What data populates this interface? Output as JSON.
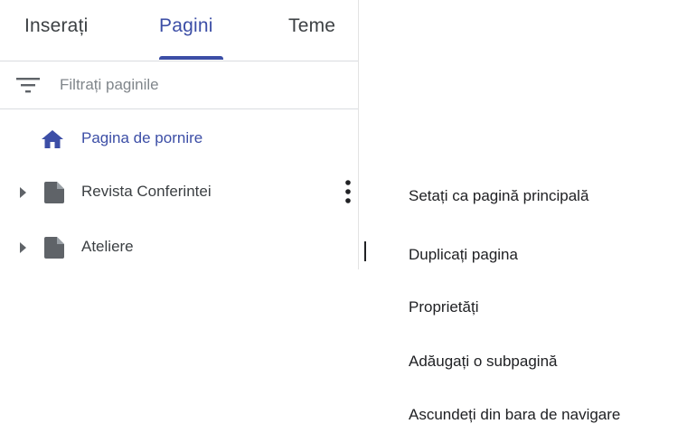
{
  "tabs": [
    {
      "label": "Inserați",
      "active": false
    },
    {
      "label": "Pagini",
      "active": true
    },
    {
      "label": "Teme",
      "active": false
    }
  ],
  "filter": {
    "placeholder": "Filtrați paginile",
    "value": "",
    "icon": "filter-list-icon"
  },
  "pages": [
    {
      "label": "Pagina de pornire",
      "icon": "home-icon",
      "selected": true
    },
    {
      "label": "Revista Conferintei",
      "icon": "page-icon",
      "expandable": true
    },
    {
      "label": "Ateliere",
      "icon": "page-icon",
      "expandable": true
    }
  ],
  "more_icon": "more-vert-icon",
  "context_menu": {
    "items": [
      {
        "label": "Setați ca pagină principală"
      },
      {
        "label": "Duplicați pagina"
      },
      {
        "label": "Proprietăți"
      },
      {
        "label": "Adăugați o subpagină"
      },
      {
        "label": "Ascundeți din bara de navigare"
      }
    ]
  },
  "colors": {
    "accent": "#3c4ea6",
    "text": "#3c4043",
    "icon_gray": "#5f6368",
    "divider": "#dadce0"
  }
}
